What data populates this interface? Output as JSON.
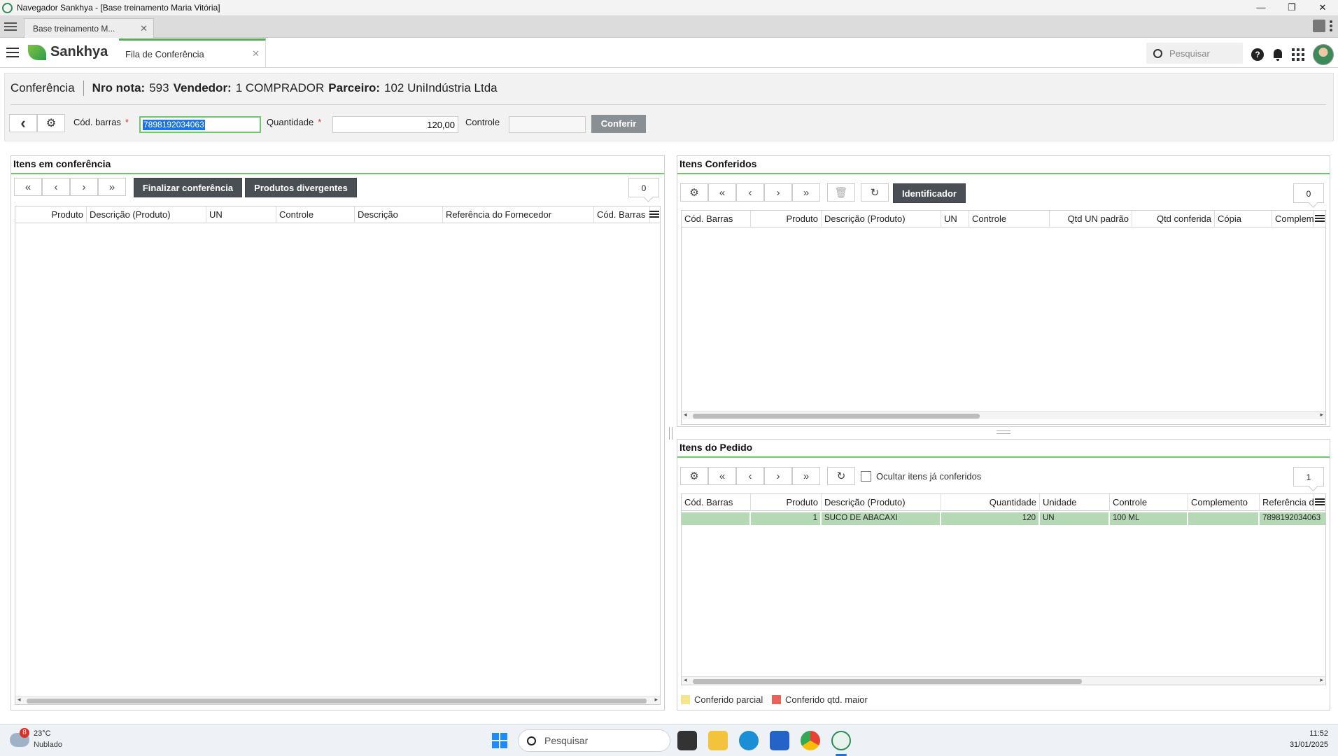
{
  "window": {
    "title": "Navegador Sankhya - [Base treinamento Maria Vitória]",
    "minimize": "—",
    "restore": "❐",
    "close": "✕"
  },
  "browser": {
    "tab_label": "Base treinamento M...",
    "tab_close": "✕"
  },
  "app": {
    "brand": "Sankhya",
    "tab_label": "Fila de Conferência",
    "tab_close": "✕",
    "search_placeholder": "Pesquisar",
    "help_label": "?"
  },
  "header": {
    "title": "Conferência",
    "nro_nota_label": "Nro nota:",
    "nro_nota_value": "593",
    "vendedor_label": "Vendedor:",
    "vendedor_value": "1 COMPRADOR",
    "parceiro_label": "Parceiro:",
    "parceiro_value": "102 UniIndústria Ltda",
    "back_icon": "‹",
    "gear_icon": "⚙",
    "cod_barras_label": "Cód. barras",
    "cod_barras_value": "7898192034063",
    "quantidade_label": "Quantidade",
    "quantidade_value": "120,00",
    "controle_label": "Controle",
    "controle_value": "",
    "conferir_label": "Conferir",
    "required_mark": "*"
  },
  "itens_conferencia": {
    "title": "Itens em conferência",
    "finalizar_label": "Finalizar conferência",
    "divergentes_label": "Produtos divergentes",
    "count": "0",
    "columns": [
      "Produto",
      "Descrição (Produto)",
      "UN",
      "Controle",
      "Descrição",
      "Referência do Fornecedor",
      "Cód. Barras"
    ]
  },
  "itens_conferidos": {
    "title": "Itens Conferidos",
    "identificador_label": "Identificador",
    "count": "0",
    "columns": [
      "Cód. Barras",
      "Produto",
      "Descrição (Produto)",
      "UN",
      "Controle",
      "Qtd UN padrão",
      "Qtd conferida",
      "Cópia",
      "Complemento"
    ]
  },
  "itens_pedido": {
    "title": "Itens do Pedido",
    "ocultar_label": "Ocultar itens já conferidos",
    "count": "1",
    "columns": [
      "Cód. Barras",
      "Produto",
      "Descrição (Produto)",
      "Quantidade",
      "Unidade",
      "Controle",
      "Complemento",
      "Referência do Fornecedor"
    ],
    "rows": [
      {
        "cod_barras": "",
        "produto": "1",
        "descricao": "SUCO DE ABACAXI",
        "quantidade": "120",
        "unidade": "UN",
        "controle": "100 ML",
        "complemento": "",
        "referencia": "7898192034063"
      }
    ]
  },
  "legend": {
    "parcial": "Conferido parcial",
    "maior": "Conferido qtd. maior",
    "parcial_color": "#f5e58c",
    "maior_color": "#e8625a"
  },
  "taskbar": {
    "weather_badge": "8",
    "temperature": "23°C",
    "condition": "Nublado",
    "search_placeholder": "Pesquisar",
    "time": "11:52",
    "date": "31/01/2025"
  },
  "colors": {
    "accent_green": "#6bc86b",
    "dark_button": "#4a4f55",
    "row_highlight": "#b5d9b5"
  }
}
